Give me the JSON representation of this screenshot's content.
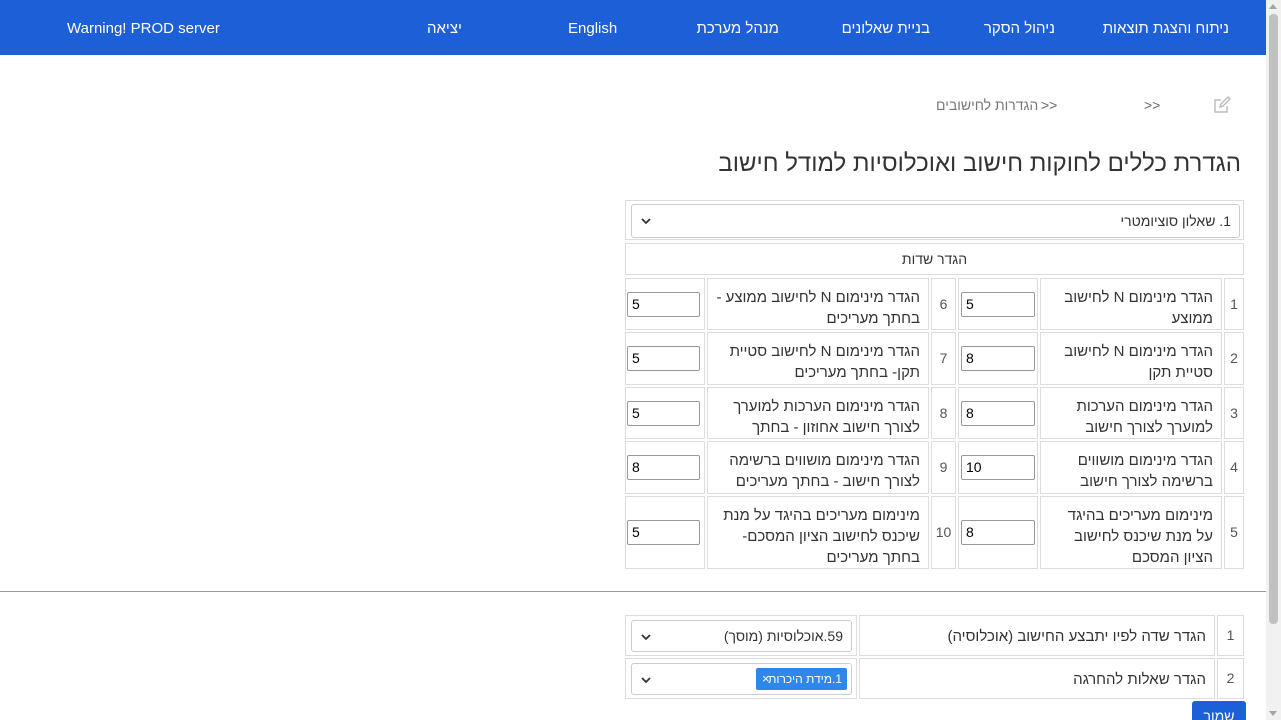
{
  "nav": {
    "items": [
      "ניתוח והצגת תוצאות",
      "ניהול הסקר",
      "בניית שאלונים",
      "מנהל מערכת",
      "English",
      "יציאה"
    ],
    "warning": "Warning! PROD server"
  },
  "breadcrumb": {
    "sep1": ">>",
    "sep2": ">>",
    "current": "הגדרות לחישובים"
  },
  "page_title": "הגדרת כללים לחוקות חישוב ואוכלוסיות למודל חישוב",
  "questionnaire_select": {
    "value": "1. שאלון סוציומטרי"
  },
  "fields_header": "הגדר שדות",
  "rows": [
    {
      "num_right": "1",
      "label_right": "הגדר מינימום N לחישוב ממוצע",
      "value_right": "5",
      "num_left": "6",
      "label_left": "הגדר מינימום N לחישוב ממוצע - בחתך מעריכים",
      "value_left": "5"
    },
    {
      "num_right": "2",
      "label_right": "הגדר מינימום N לחישוב סטיית תקן",
      "value_right": "8",
      "num_left": "7",
      "label_left": "הגדר מינימום N לחישוב סטיית תקן- בחתך מעריכים",
      "value_left": "5"
    },
    {
      "num_right": "3",
      "label_right": "הגדר מינימום הערכות למוערך לצורך חישוב אחוזון",
      "value_right": "8",
      "num_left": "8",
      "label_left": "הגדר מינימום הערכות למוערך לצורך חישוב אחוזון - בחתך מעריכים",
      "value_left": "5"
    },
    {
      "num_right": "4",
      "label_right": "הגדר מינימום מושווים ברשימה לצורך חישוב אחוזון",
      "value_right": "10",
      "num_left": "9",
      "label_left": "הגדר מינימום מושווים ברשימה לצורך חישוב - בחתך מעריכים",
      "value_left": "8"
    },
    {
      "num_right": "5",
      "label_right": "מינימום מעריכים בהיגד על מנת שיכנס לחישוב הציון המסכם",
      "value_right": "8",
      "num_left": "10",
      "label_left": "מינימום מעריכים בהיגד על מנת שיכנס לחישוב הציון המסכם- בחתך מעריכים",
      "value_left": "5"
    }
  ],
  "bottom_rows": [
    {
      "num": "1",
      "label": "הגדר שדה לפיו יתבצע החישוב (אוכלוסיה)",
      "select_value": "59.אוכלוסיות (מוסך)"
    },
    {
      "num": "2",
      "label": "הגדר שאלות להחרגה",
      "tag": "1.מידת היכרות",
      "tag_remove": "×"
    }
  ],
  "submit_label": "שמור",
  "colors": {
    "navbar": "#1d5fd6",
    "tag": "#2f86eb"
  }
}
